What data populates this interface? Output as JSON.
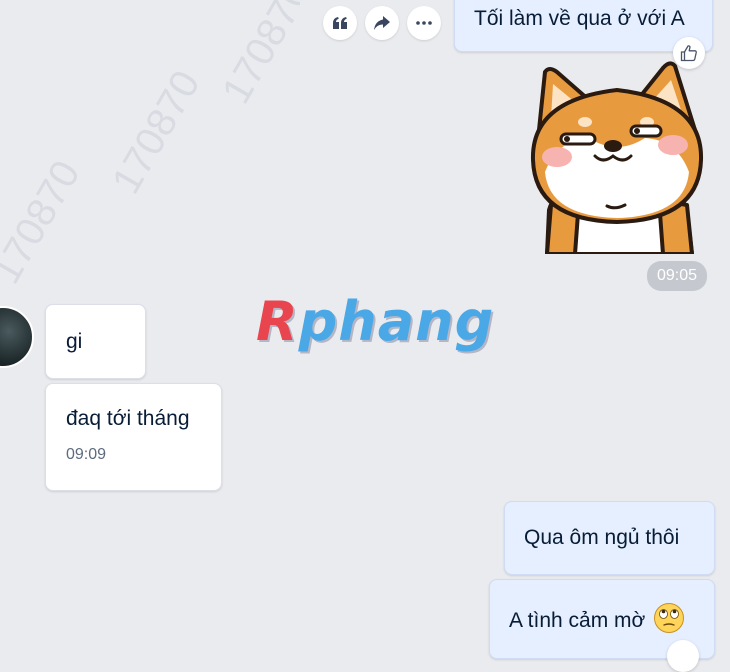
{
  "actions": {
    "quote_icon": "quote-icon",
    "forward_icon": "share-arrow-icon",
    "more_icon": "more-dots-icon"
  },
  "messages": {
    "top_self": "Tối làm về qua ở với A",
    "sticker_time": "09:05",
    "other_1": "gi",
    "other_2": "đaq tới tháng",
    "other_2_time": "09:09",
    "self_1": "Qua ôm ngủ thôi",
    "self_2": "A tình cảm mờ"
  },
  "watermark": {
    "logo_first": "R",
    "logo_rest": "phang",
    "tile": "170870"
  },
  "colors": {
    "background": "#eaebef",
    "self_bubble": "#e5efff",
    "other_bubble": "#ffffff",
    "logo_blue": "#4aa8e6",
    "logo_red": "#e8454e"
  }
}
